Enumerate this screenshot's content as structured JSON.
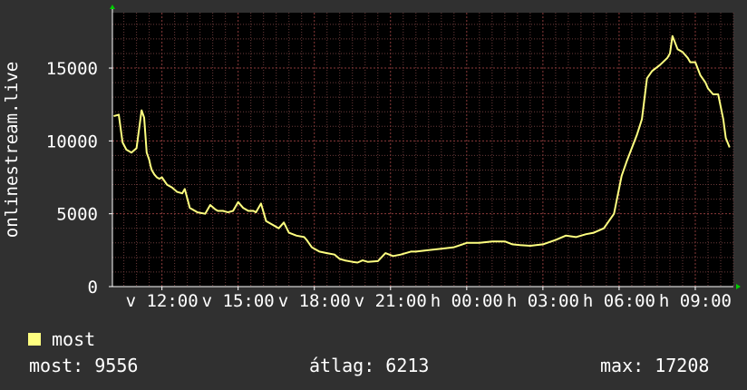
{
  "colors": {
    "background": "#303030",
    "plot_background": "#000000",
    "grid": "#6a3a3a",
    "axis": "#ffffff",
    "line": "#ffff80",
    "axis_arrow": "#00cc00"
  },
  "legend": {
    "swatch_color": "#ffff80",
    "label": "most"
  },
  "stats": {
    "now_label": "most:",
    "now_value": "9556",
    "avg_label": "átlag:",
    "avg_value": "6213",
    "max_label": "max:",
    "max_value": "17208"
  },
  "chart_data": {
    "type": "line",
    "title": "",
    "xlabel": "",
    "ylabel": "onlinestream.live",
    "ylim": [
      0,
      18800
    ],
    "yticks": [
      0,
      5000,
      10000,
      15000
    ],
    "xticks": [
      {
        "label": "v 12:00",
        "hour": 12
      },
      {
        "label": "v 15:00",
        "hour": 15
      },
      {
        "label": "v 18:00",
        "hour": 18
      },
      {
        "label": "v 21:00",
        "hour": 21
      },
      {
        "label": "h 00:00",
        "hour": 24
      },
      {
        "label": "h 03:00",
        "hour": 27
      },
      {
        "label": "h 06:00",
        "hour": 30
      },
      {
        "label": "h 09:00",
        "hour": 33
      }
    ],
    "xlim_hours": [
      10.05,
      34.5
    ],
    "grid": true,
    "series": [
      {
        "name": "most",
        "color": "#ffff80",
        "x_hours": [
          10.1,
          10.3,
          10.45,
          10.6,
          10.8,
          11.0,
          11.2,
          11.3,
          11.4,
          11.5,
          11.55,
          11.6,
          11.7,
          11.8,
          11.9,
          12.0,
          12.2,
          12.4,
          12.6,
          12.8,
          12.9,
          13.1,
          13.4,
          13.7,
          13.9,
          14.1,
          14.2,
          14.4,
          14.6,
          14.8,
          15.0,
          15.2,
          15.4,
          15.6,
          15.7,
          15.9,
          16.1,
          16.4,
          16.6,
          16.8,
          17.0,
          17.3,
          17.6,
          17.7,
          17.9,
          18.2,
          18.5,
          18.8,
          19.0,
          19.2,
          19.5,
          19.7,
          19.9,
          20.1,
          20.5,
          20.8,
          21.1,
          21.4,
          21.6,
          21.8,
          22.0,
          22.5,
          23.0,
          23.5,
          24.0,
          24.5,
          25.0,
          25.5,
          25.8,
          26.1,
          26.5,
          27.0,
          27.5,
          27.9,
          28.3,
          28.7,
          29.0,
          29.4,
          29.8,
          30.1,
          30.3,
          30.5,
          30.7,
          30.9,
          31.1,
          31.3,
          31.6,
          31.9,
          32.0,
          32.1,
          32.3,
          32.5,
          32.7,
          32.8,
          33.0,
          33.2,
          33.4,
          33.5,
          33.7,
          33.9,
          34.1,
          34.2,
          34.35
        ],
        "values": [
          11700,
          11800,
          9900,
          9400,
          9200,
          9500,
          12100,
          11600,
          9200,
          8700,
          8300,
          8000,
          7700,
          7500,
          7400,
          7500,
          7000,
          6800,
          6500,
          6400,
          6700,
          5400,
          5100,
          5000,
          5600,
          5300,
          5200,
          5200,
          5100,
          5200,
          5800,
          5400,
          5200,
          5200,
          5100,
          5700,
          4500,
          4200,
          4000,
          4400,
          3700,
          3500,
          3400,
          3200,
          2700,
          2400,
          2300,
          2200,
          1900,
          1800,
          1700,
          1650,
          1800,
          1700,
          1750,
          2300,
          2100,
          2200,
          2300,
          2400,
          2400,
          2500,
          2600,
          2700,
          3000,
          3000,
          3100,
          3100,
          2900,
          2850,
          2800,
          2900,
          3200,
          3500,
          3400,
          3600,
          3700,
          4000,
          5000,
          7600,
          8600,
          9500,
          10400,
          11500,
          14300,
          14800,
          15200,
          15700,
          16000,
          17200,
          16300,
          16100,
          15700,
          15400,
          15400,
          14500,
          14000,
          13600,
          13200,
          13200,
          11500,
          10200,
          9556
        ]
      }
    ]
  }
}
